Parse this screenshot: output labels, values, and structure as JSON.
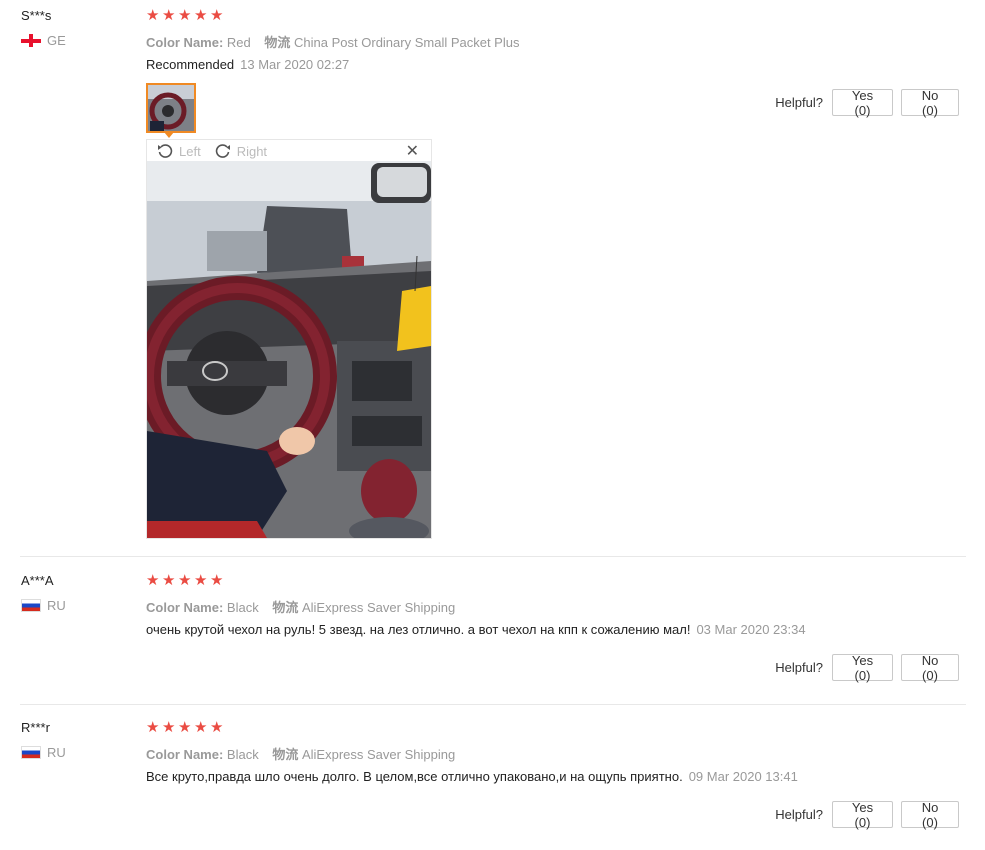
{
  "reviews": [
    {
      "user": "S***s",
      "country": "GE",
      "stars": 5,
      "color_label": "Color Name:",
      "color_value": "Red",
      "shipping_label": "物流",
      "shipping_value": "China Post Ordinary Small Packet Plus",
      "text": "Recommended",
      "date": "13 Mar 2020 02:27",
      "helpful_label": "Helpful?",
      "yes_label": "Yes (0)",
      "no_label": "No (0)"
    },
    {
      "user": "A***A",
      "country": "RU",
      "stars": 5,
      "color_label": "Color Name:",
      "color_value": "Black",
      "shipping_label": "物流",
      "shipping_value": "AliExpress Saver Shipping",
      "text": "очень крутой чехол на руль! 5 звезд. на лез отлично. а вот чехол на кпп к сожалению мал!",
      "date": "03 Mar 2020 23:34",
      "helpful_label": "Helpful?",
      "yes_label": "Yes (0)",
      "no_label": "No (0)"
    },
    {
      "user": "R***r",
      "country": "RU",
      "stars": 5,
      "color_label": "Color Name:",
      "color_value": "Black",
      "shipping_label": "物流",
      "shipping_value": "AliExpress Saver Shipping",
      "text": "Все круто,правда шло очень долго. В целом,все отлично упаковано,и на ощупь приятно.",
      "date": "09 Mar 2020 13:41",
      "helpful_label": "Helpful?",
      "yes_label": "Yes (0)",
      "no_label": "No (0)"
    }
  ],
  "viewer": {
    "rotate_left_label": "Left",
    "rotate_right_label": "Right",
    "close_icon": "close-icon"
  },
  "colors": {
    "star": "#ea4c43",
    "thumb_border": "#f08a24",
    "muted_text": "#999999"
  }
}
